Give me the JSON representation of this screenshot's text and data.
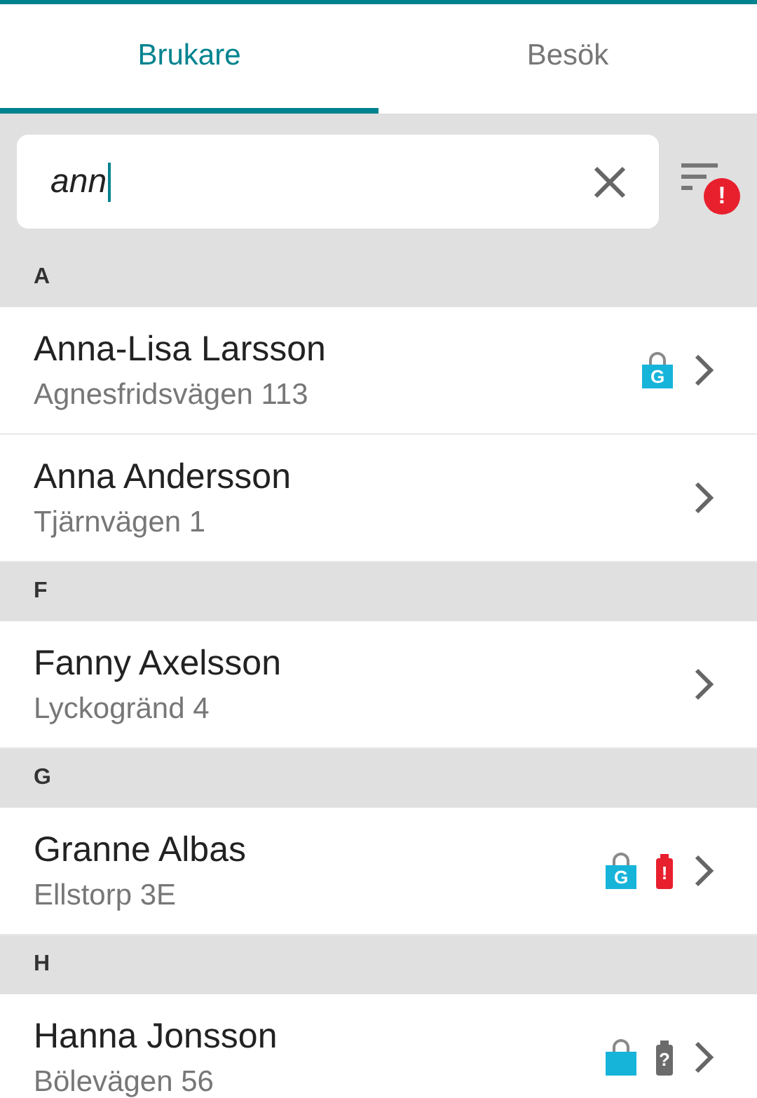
{
  "tabs": [
    {
      "label": "Brukare",
      "selected": true
    },
    {
      "label": "Besök",
      "selected": false
    }
  ],
  "search": {
    "value": "ann",
    "filter_badge": "!"
  },
  "sections": [
    {
      "letter": "A",
      "items": [
        {
          "name": "Anna-Lisa Larsson",
          "address": "Agnesfridsvägen 113",
          "indicators": [
            {
              "kind": "bag",
              "letter": "G"
            }
          ]
        },
        {
          "name": "Anna Andersson",
          "address": "Tjärnvägen 1"
        }
      ]
    },
    {
      "letter": "F",
      "items": [
        {
          "name": "Fanny Axelsson",
          "address": "Lyckogränd 4"
        }
      ]
    },
    {
      "letter": "G",
      "items": [
        {
          "name": "Granne Albas",
          "address": "Ellstorp 3E",
          "indicators": [
            {
              "kind": "bag",
              "letter": "G"
            },
            {
              "kind": "battery",
              "symbol": "!",
              "color": "#e8202e"
            }
          ]
        }
      ]
    },
    {
      "letter": "H",
      "items": [
        {
          "name": "Hanna Jonsson",
          "address": "Bölevägen 56",
          "indicators": [
            {
              "kind": "bag"
            },
            {
              "kind": "battery",
              "symbol": "?",
              "color": "#6b6b6b"
            }
          ]
        }
      ]
    }
  ]
}
